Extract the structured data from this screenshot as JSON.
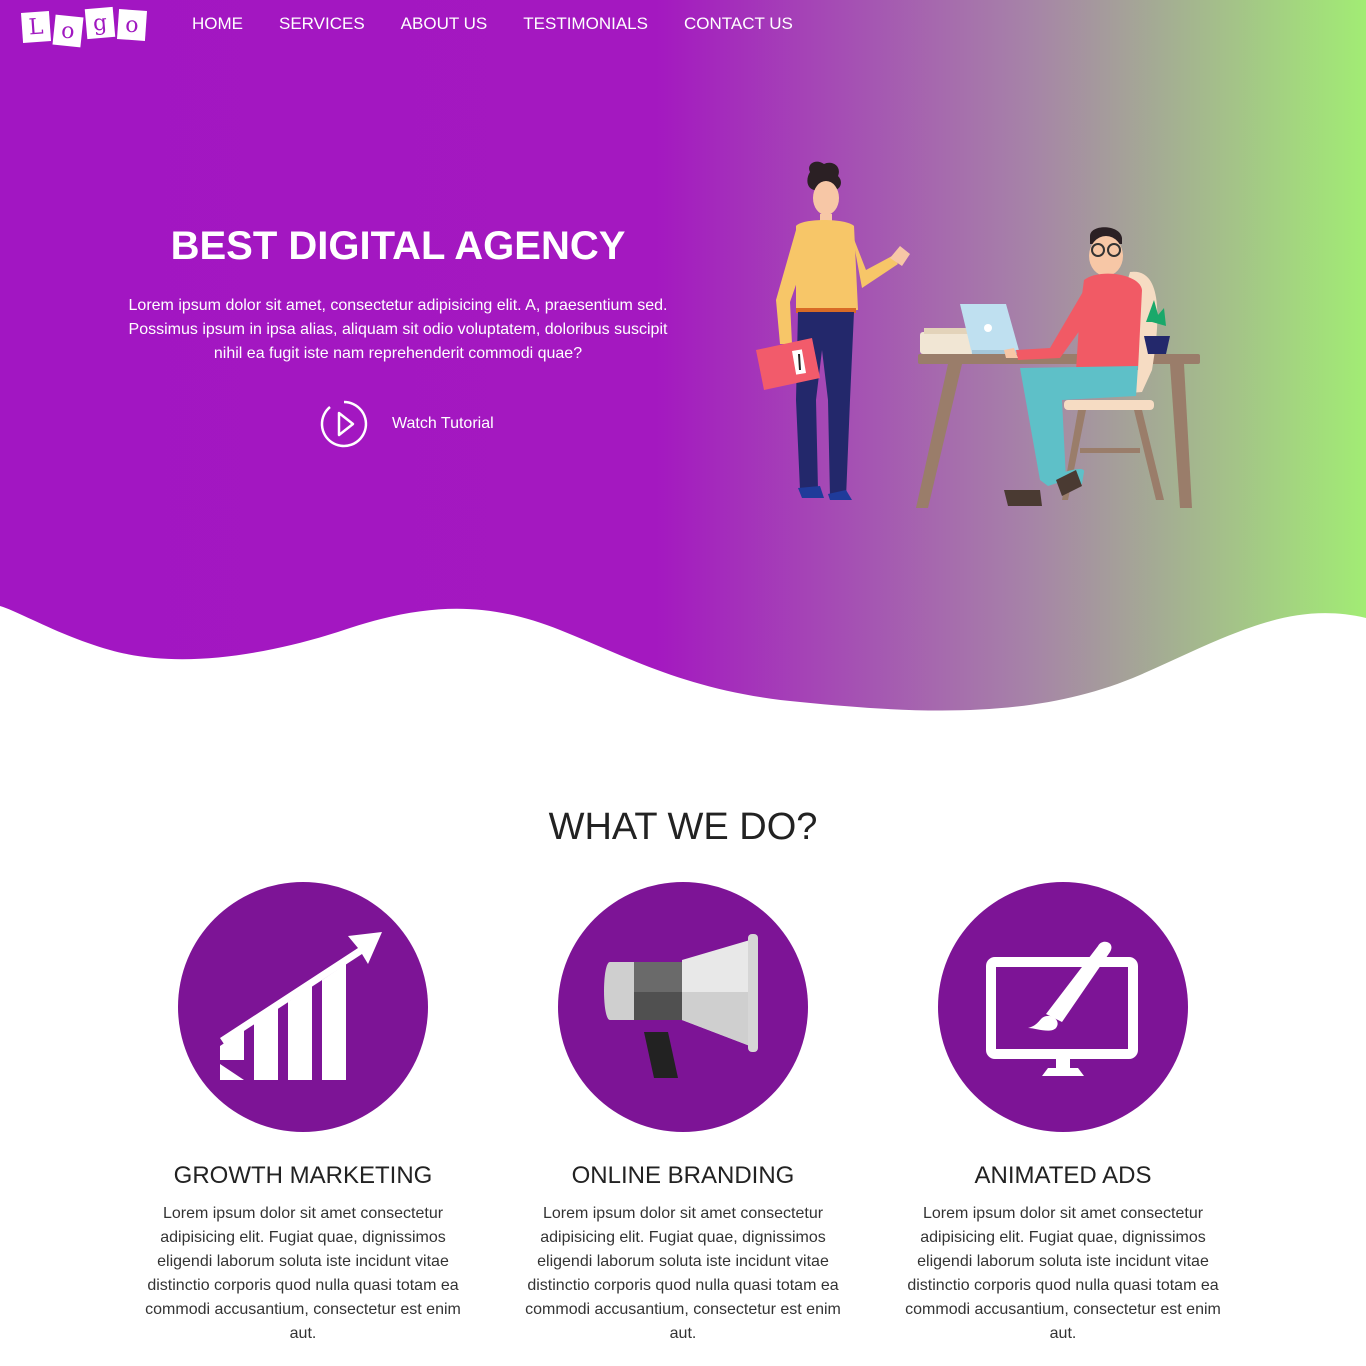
{
  "logo": {
    "letters": [
      "L",
      "o",
      "g",
      "o"
    ]
  },
  "nav": {
    "items": [
      "HOME",
      "SERVICES",
      "ABOUT US",
      "TESTIMONIALS",
      "CONTACT US"
    ]
  },
  "hero": {
    "title": "BEST DIGITAL AGENCY",
    "text": "Lorem ipsum dolor sit amet, consectetur adipisicing elit. A, praesentium sed. Possimus ipsum in ipsa alias, aliquam sit odio voluptatem, doloribus suscipit nihil ea fugit iste nam reprehenderit commodi quae?",
    "watch_label": "Watch Tutorial",
    "gradient_start": "#a216c2",
    "gradient_end": "#a2ec74"
  },
  "services": {
    "title": "WHAT WE DO?",
    "accent": "#7d1496",
    "items": [
      {
        "title": "GROWTH MARKETING",
        "icon": "growth-chart-icon",
        "text": "Lorem ipsum dolor sit amet consectetur adipisicing elit. Fugiat quae, dignissimos eligendi laborum soluta iste incidunt vitae distinctio corporis quod nulla quasi totam ea commodi accusantium, consectetur est enim aut."
      },
      {
        "title": "ONLINE BRANDING",
        "icon": "megaphone-icon",
        "text": "Lorem ipsum dolor sit amet consectetur adipisicing elit. Fugiat quae, dignissimos eligendi laborum soluta iste incidunt vitae distinctio corporis quod nulla quasi totam ea commodi accusantium, consectetur est enim aut."
      },
      {
        "title": "ANIMATED ADS",
        "icon": "monitor-brush-icon",
        "text": "Lorem ipsum dolor sit amet consectetur adipisicing elit. Fugiat quae, dignissimos eligendi laborum soluta iste incidunt vitae distinctio corporis quod nulla quasi totam ea commodi accusantium, consectetur est enim aut."
      }
    ]
  }
}
